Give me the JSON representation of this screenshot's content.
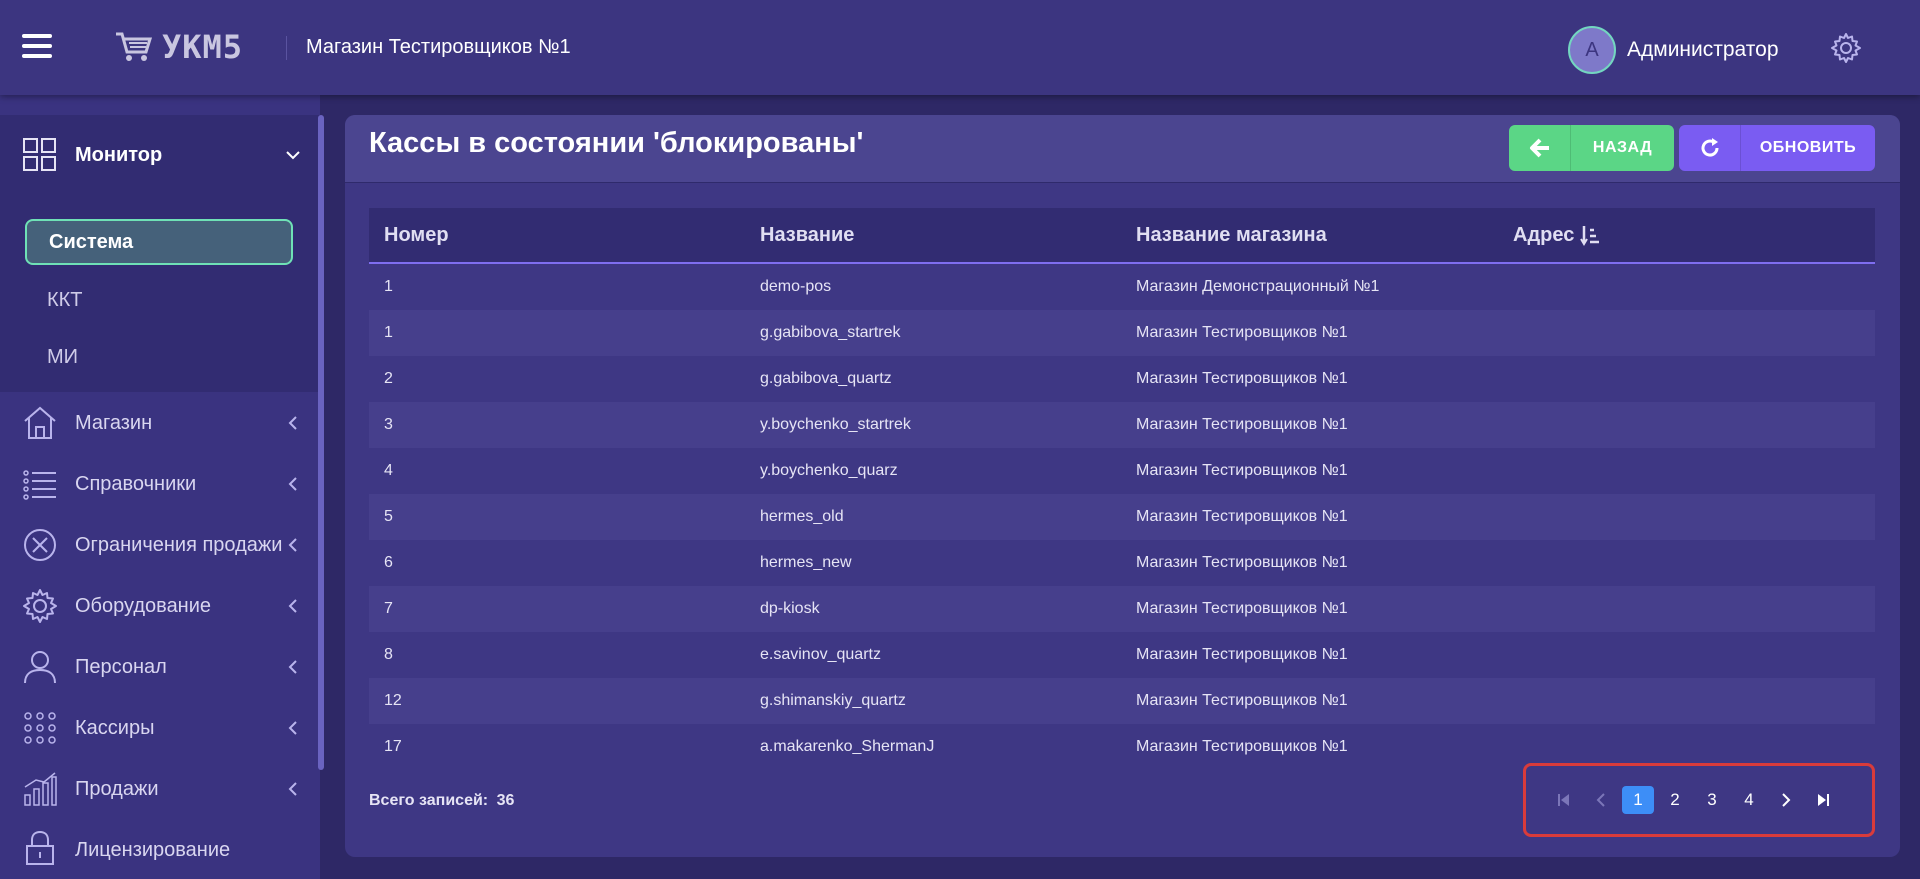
{
  "header": {
    "logo_text": "УКМ5",
    "store_title": "Магазин Тестировщиков №1",
    "avatar_letter": "А",
    "user_name": "Администратор"
  },
  "sidebar": {
    "monitor": {
      "label": "Монитор",
      "icon": "dashboard-grid-icon",
      "sub_items": [
        {
          "label": "Система",
          "active": true
        },
        {
          "label": "ККТ",
          "active": false
        },
        {
          "label": "МИ",
          "active": false
        }
      ]
    },
    "items": [
      {
        "label": "Магазин",
        "icon": "store-icon"
      },
      {
        "label": "Справочники",
        "icon": "list-icon"
      },
      {
        "label": "Ограничения продажи",
        "icon": "restriction-icon"
      },
      {
        "label": "Оборудование",
        "icon": "gear-icon"
      },
      {
        "label": "Персонал",
        "icon": "person-icon"
      },
      {
        "label": "Кассиры",
        "icon": "dots-grid-icon"
      },
      {
        "label": "Продажи",
        "icon": "chart-icon"
      },
      {
        "label": "Лицензирование",
        "icon": "lock-icon"
      }
    ]
  },
  "main": {
    "title": "Кассы в состоянии 'блокированы'",
    "back_label": "НАЗАД",
    "refresh_label": "ОБНОВИТЬ",
    "columns": [
      "Номер",
      "Название",
      "Название магазина",
      "Адрес"
    ],
    "rows": [
      [
        "1",
        "demo-pos",
        "Магазин Демонстрационный №1",
        ""
      ],
      [
        "1",
        "g.gabibova_startrek",
        "Магазин Тестировщиков №1",
        ""
      ],
      [
        "2",
        "g.gabibova_quartz",
        "Магазин Тестировщиков №1",
        ""
      ],
      [
        "3",
        "y.boychenko_startrek",
        "Магазин Тестировщиков №1",
        ""
      ],
      [
        "4",
        "y.boychenko_quarz",
        "Магазин Тестировщиков №1",
        ""
      ],
      [
        "5",
        "hermes_old",
        "Магазин Тестировщиков №1",
        ""
      ],
      [
        "6",
        "hermes_new",
        "Магазин Тестировщиков №1",
        ""
      ],
      [
        "7",
        "dp-kiosk",
        "Магазин Тестировщиков №1",
        ""
      ],
      [
        "8",
        "e.savinov_quartz",
        "Магазин Тестировщиков №1",
        ""
      ],
      [
        "12",
        "g.shimanskiy_quartz",
        "Магазин Тестировщиков №1",
        ""
      ],
      [
        "17",
        "a.makarenko_ShermanJ",
        "Магазин Тестировщиков №1",
        ""
      ]
    ],
    "total_label": "Всего записей:",
    "total_count": "36",
    "pagination": {
      "pages": [
        "1",
        "2",
        "3",
        "4"
      ],
      "current": "1"
    }
  },
  "colors": {
    "accent_green": "#5bd686",
    "accent_purple": "#7a5cf2",
    "active_page": "#3d8ef7",
    "highlight_border": "#d93b3b"
  }
}
